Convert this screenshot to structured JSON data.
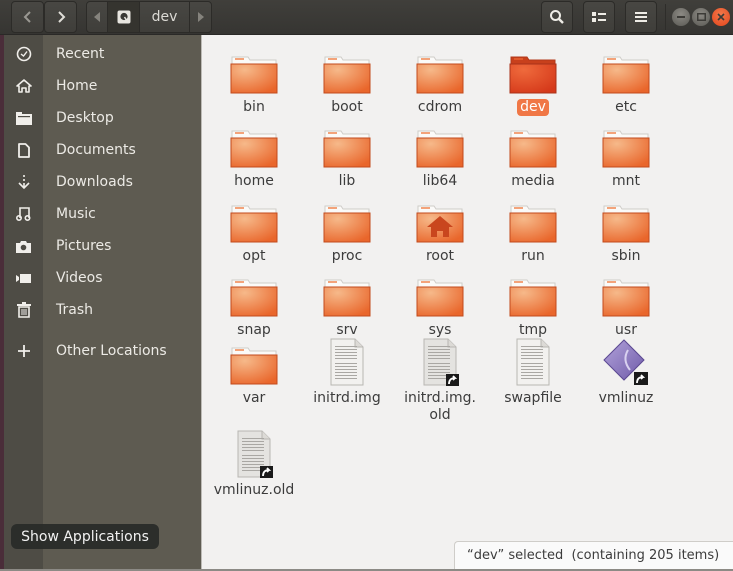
{
  "window": {
    "title": "dev",
    "controls": {
      "minimize": "minimize-icon",
      "maximize": "maximize-icon",
      "close": "close-icon"
    }
  },
  "toolbar": {
    "back_icon": "chevron-left-icon",
    "forward_icon": "chevron-right-icon",
    "path_scroll_left_icon": "triangle-left-icon",
    "path_scroll_right_icon": "triangle-right-icon",
    "path": [
      {
        "label": "",
        "icon": "drive-icon"
      },
      {
        "label": "dev"
      }
    ],
    "search_icon": "search-icon",
    "view_toggle_icon": "list-view-icon",
    "menu_icon": "hamburger-menu-icon"
  },
  "sidebar": {
    "items": [
      {
        "label": "Recent",
        "icon": "clock-icon"
      },
      {
        "label": "Home",
        "icon": "home-icon"
      },
      {
        "label": "Desktop",
        "icon": "folder-icon"
      },
      {
        "label": "Documents",
        "icon": "document-icon"
      },
      {
        "label": "Downloads",
        "icon": "download-icon"
      },
      {
        "label": "Music",
        "icon": "music-icon"
      },
      {
        "label": "Pictures",
        "icon": "camera-icon"
      },
      {
        "label": "Videos",
        "icon": "video-icon"
      },
      {
        "label": "Trash",
        "icon": "trash-icon"
      },
      {
        "label": "Other Locations",
        "icon": "plus-icon"
      }
    ]
  },
  "files": [
    {
      "name": "bin",
      "type": "folder"
    },
    {
      "name": "boot",
      "type": "folder"
    },
    {
      "name": "cdrom",
      "type": "folder"
    },
    {
      "name": "dev",
      "type": "folder",
      "selected": true
    },
    {
      "name": "etc",
      "type": "folder"
    },
    {
      "name": "home",
      "type": "folder"
    },
    {
      "name": "lib",
      "type": "folder"
    },
    {
      "name": "lib64",
      "type": "folder"
    },
    {
      "name": "media",
      "type": "folder"
    },
    {
      "name": "mnt",
      "type": "folder"
    },
    {
      "name": "opt",
      "type": "folder"
    },
    {
      "name": "proc",
      "type": "folder"
    },
    {
      "name": "root",
      "type": "folder-home"
    },
    {
      "name": "run",
      "type": "folder"
    },
    {
      "name": "sbin",
      "type": "folder"
    },
    {
      "name": "snap",
      "type": "folder"
    },
    {
      "name": "srv",
      "type": "folder"
    },
    {
      "name": "sys",
      "type": "folder"
    },
    {
      "name": "tmp",
      "type": "folder"
    },
    {
      "name": "usr",
      "type": "folder"
    },
    {
      "name": "var",
      "type": "folder"
    },
    {
      "name": "initrd.img",
      "type": "text-file"
    },
    {
      "name": "initrd.img.\nold",
      "type": "text-file-link"
    },
    {
      "name": "swapfile",
      "type": "text-file"
    },
    {
      "name": "vmlinuz",
      "type": "executable-link"
    },
    {
      "name": "vmlinuz.old",
      "type": "text-file-link"
    }
  ],
  "status": {
    "text": "“dev” selected  (containing 205 items)"
  },
  "dock_tooltip": {
    "text": "Show Applications"
  },
  "colors": {
    "accent": "#f07746",
    "folder": "#e9662b",
    "folder_selected": "#d9421a",
    "close": "#e95420"
  }
}
